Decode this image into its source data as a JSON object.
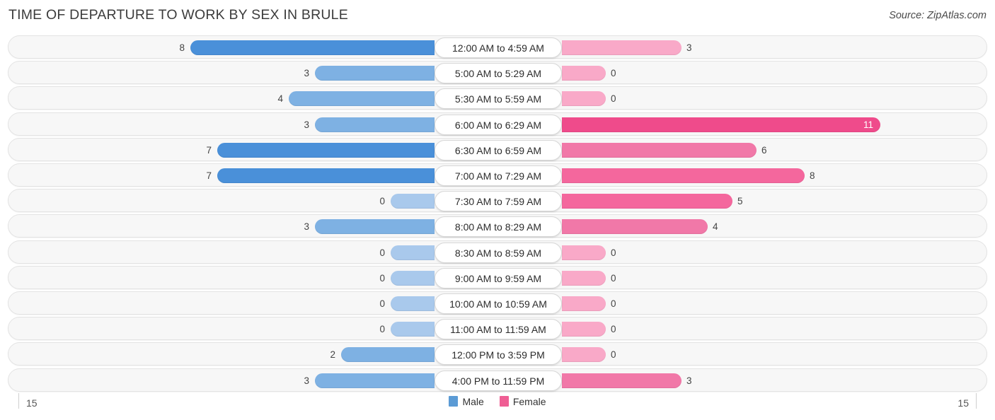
{
  "title": "TIME OF DEPARTURE TO WORK BY SEX IN BRULE",
  "source": "Source: ZipAtlas.com",
  "axis": {
    "left_label": "15",
    "right_label": "15"
  },
  "legend": {
    "items": [
      {
        "label": "Male",
        "color": "#5b9bd5"
      },
      {
        "label": "Female",
        "color": "#ef5e94"
      }
    ]
  },
  "colors": {
    "male_strong": "#4a90d9",
    "male_mid": "#7eb1e3",
    "male_light": "#a9c9ec",
    "female_strong": "#ef4b8b",
    "female_mid": "#f4679d",
    "female_mid2": "#f178a8",
    "female_light": "#f9a9c8",
    "row_bg": "#f7f7f7",
    "row_border": "#e3e3e3"
  },
  "chart_data": {
    "type": "bar",
    "subtype": "diverging-bar",
    "title": "TIME OF DEPARTURE TO WORK BY SEX IN BRULE",
    "xlabel": "",
    "ylabel": "",
    "xlim": [
      15,
      15
    ],
    "grid": false,
    "legend_position": "bottom-center",
    "categories": [
      "12:00 AM to 4:59 AM",
      "5:00 AM to 5:29 AM",
      "5:30 AM to 5:59 AM",
      "6:00 AM to 6:29 AM",
      "6:30 AM to 6:59 AM",
      "7:00 AM to 7:29 AM",
      "7:30 AM to 7:59 AM",
      "8:00 AM to 8:29 AM",
      "8:30 AM to 8:59 AM",
      "9:00 AM to 9:59 AM",
      "10:00 AM to 10:59 AM",
      "11:00 AM to 11:59 AM",
      "12:00 PM to 3:59 PM",
      "4:00 PM to 11:59 PM"
    ],
    "series": [
      {
        "name": "Male",
        "values": [
          8,
          3,
          4,
          3,
          7,
          7,
          0,
          3,
          0,
          0,
          0,
          0,
          2,
          3
        ]
      },
      {
        "name": "Female",
        "values": [
          3,
          0,
          0,
          11,
          6,
          8,
          5,
          4,
          0,
          0,
          0,
          0,
          0,
          3
        ]
      }
    ]
  },
  "rows": [
    {
      "category": "12:00 AM to 4:59 AM",
      "male": "8",
      "female": "3",
      "male_w": 345,
      "female_w": 169,
      "male_tone": "male_strong",
      "female_tone": "female_light",
      "female_inside": false
    },
    {
      "category": "5:00 AM to 5:29 AM",
      "male": "3",
      "female": "0",
      "male_w": 169,
      "female_w": 62,
      "male_tone": "male_mid",
      "female_tone": "female_light",
      "female_inside": false
    },
    {
      "category": "5:30 AM to 5:59 AM",
      "male": "4",
      "female": "0",
      "male_w": 206,
      "female_w": 62,
      "male_tone": "male_mid",
      "female_tone": "female_light",
      "female_inside": false
    },
    {
      "category": "6:00 AM to 6:29 AM",
      "male": "3",
      "female": "11",
      "male_w": 169,
      "female_w": 450,
      "male_tone": "male_mid",
      "female_tone": "female_strong",
      "female_inside": true
    },
    {
      "category": "6:30 AM to 6:59 AM",
      "male": "7",
      "female": "6",
      "male_w": 307,
      "female_w": 275,
      "male_tone": "male_strong",
      "female_tone": "female_mid2",
      "female_inside": false
    },
    {
      "category": "7:00 AM to 7:29 AM",
      "male": "7",
      "female": "8",
      "male_w": 307,
      "female_w": 343,
      "male_tone": "male_strong",
      "female_tone": "female_mid",
      "female_inside": false
    },
    {
      "category": "7:30 AM to 7:59 AM",
      "male": "0",
      "female": "5",
      "male_w": 62,
      "female_w": 241,
      "male_tone": "male_light",
      "female_tone": "female_mid",
      "female_inside": false
    },
    {
      "category": "8:00 AM to 8:29 AM",
      "male": "3",
      "female": "4",
      "male_w": 169,
      "female_w": 206,
      "male_tone": "male_mid",
      "female_tone": "female_mid2",
      "female_inside": false
    },
    {
      "category": "8:30 AM to 8:59 AM",
      "male": "0",
      "female": "0",
      "male_w": 62,
      "female_w": 62,
      "male_tone": "male_light",
      "female_tone": "female_light",
      "female_inside": false
    },
    {
      "category": "9:00 AM to 9:59 AM",
      "male": "0",
      "female": "0",
      "male_w": 62,
      "female_w": 62,
      "male_tone": "male_light",
      "female_tone": "female_light",
      "female_inside": false
    },
    {
      "category": "10:00 AM to 10:59 AM",
      "male": "0",
      "female": "0",
      "male_w": 62,
      "female_w": 62,
      "male_tone": "male_light",
      "female_tone": "female_light",
      "female_inside": false
    },
    {
      "category": "11:00 AM to 11:59 AM",
      "male": "0",
      "female": "0",
      "male_w": 62,
      "female_w": 62,
      "male_tone": "male_light",
      "female_tone": "female_light",
      "female_inside": false
    },
    {
      "category": "12:00 PM to 3:59 PM",
      "male": "2",
      "female": "0",
      "male_w": 132,
      "female_w": 62,
      "male_tone": "male_mid",
      "female_tone": "female_light",
      "female_inside": false
    },
    {
      "category": "4:00 PM to 11:59 PM",
      "male": "3",
      "female": "3",
      "male_w": 169,
      "female_w": 169,
      "male_tone": "male_mid",
      "female_tone": "female_mid2",
      "female_inside": false
    }
  ]
}
